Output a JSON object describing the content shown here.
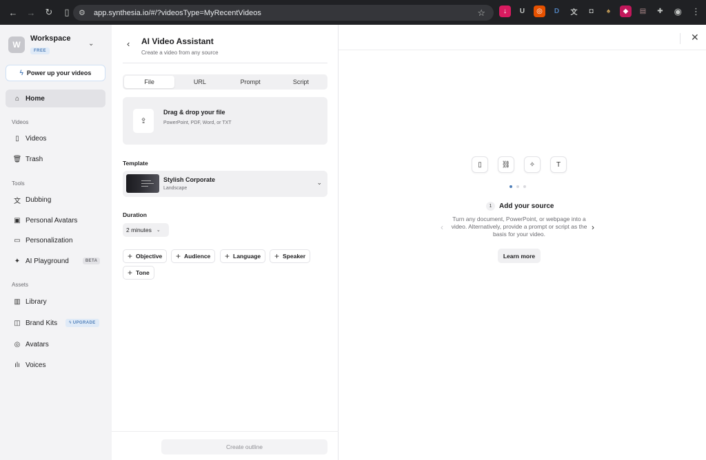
{
  "browser": {
    "url": "app.synthesia.io/#/?videosType=MyRecentVideos",
    "extensions": [
      "download-ext-icon",
      "u-ext-icon",
      "instagram-ext-icon",
      "d-ext-icon",
      "translate-ext-icon",
      "camera-ext-icon",
      "leaf-ext-icon",
      "shield-ext-icon",
      "folder-ext-icon",
      "puzzle-ext-icon"
    ],
    "ext_letters": {
      "u": "U",
      "d": "D"
    }
  },
  "sidebar": {
    "workspace": {
      "initial": "W",
      "name": "Workspace",
      "badge": "FREE"
    },
    "power_button": "Power up your videos",
    "home": "Home",
    "sections": {
      "videos": "Videos",
      "tools": "Tools",
      "assets": "Assets"
    },
    "videos_items": [
      "Videos",
      "Trash"
    ],
    "tools_items": [
      "Dubbing",
      "Personal Avatars",
      "Personalization",
      "AI Playground"
    ],
    "tools_badge": "BETA",
    "assets_items": [
      "Library",
      "Brand Kits",
      "Avatars",
      "Voices"
    ],
    "assets_badge": "UPGRADE"
  },
  "assistant": {
    "title": "AI Video Assistant",
    "subtitle": "Create a video from any source",
    "tabs": [
      "File",
      "URL",
      "Prompt",
      "Script"
    ],
    "active_tab": "File",
    "dropzone": {
      "title": "Drag & drop your file",
      "formats": "PowerPoint, PDF, Word, or TXT"
    },
    "template_label": "Template",
    "template": {
      "name": "Stylish Corporate",
      "format": "Landscape"
    },
    "duration_label": "Duration",
    "duration_value": "2 minutes",
    "chips": [
      "Objective",
      "Audience",
      "Language",
      "Speaker",
      "Tone"
    ],
    "create_button": "Create outline"
  },
  "onboarding": {
    "step_number": "1",
    "step_title": "Add your source",
    "step_description": "Turn any document, PowerPoint, or webpage into a video. Alternatively, provide a prompt or script as the basis for your video.",
    "learn_more": "Learn more",
    "current_dot": 1,
    "dot_count": 3
  },
  "colors": {
    "accent": "#4f7fb9",
    "sidebar_bg": "#f3f3f5",
    "chrome_bg": "#202124"
  }
}
